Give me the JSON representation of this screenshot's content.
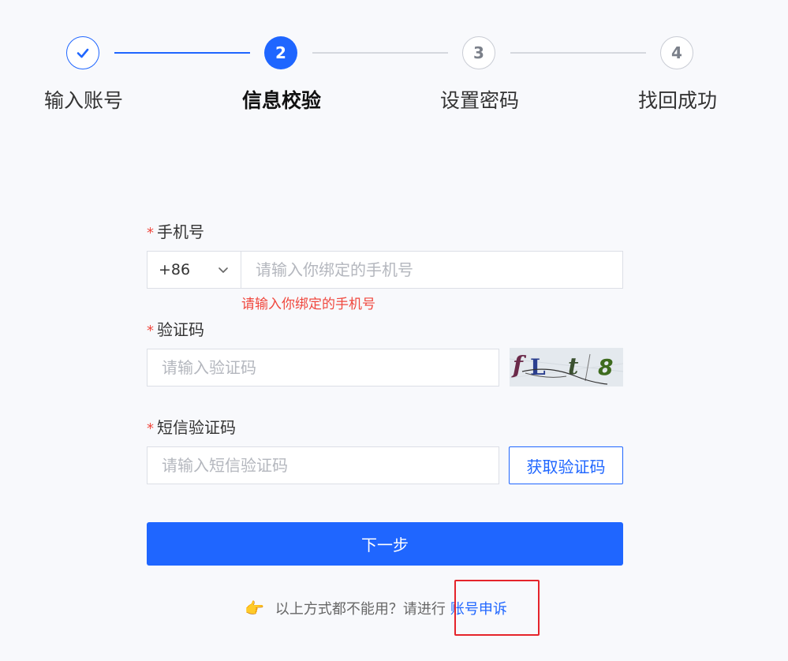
{
  "steps": [
    {
      "number": "1",
      "label": "输入账号",
      "state": "done"
    },
    {
      "number": "2",
      "label": "信息校验",
      "state": "active"
    },
    {
      "number": "3",
      "label": "设置密码",
      "state": "todo"
    },
    {
      "number": "4",
      "label": "找回成功",
      "state": "todo"
    }
  ],
  "colors": {
    "primary": "#1f66ff",
    "error": "#f0483e",
    "highlight": "#e5242b"
  },
  "form": {
    "phone": {
      "label": "手机号",
      "country_code": "+86",
      "placeholder": "请输入你绑定的手机号",
      "error": "请输入你绑定的手机号"
    },
    "captcha": {
      "label": "验证码",
      "placeholder": "请输入验证码",
      "image_text": "fLt8"
    },
    "sms": {
      "label": "短信验证码",
      "placeholder": "请输入短信验证码",
      "button_label": "获取验证码"
    },
    "required_mark": "*",
    "next_label": "下一步"
  },
  "footer": {
    "hint": "以上方式都不能用？请进行",
    "link_label": "账号申诉",
    "hand_icon": "👉"
  }
}
